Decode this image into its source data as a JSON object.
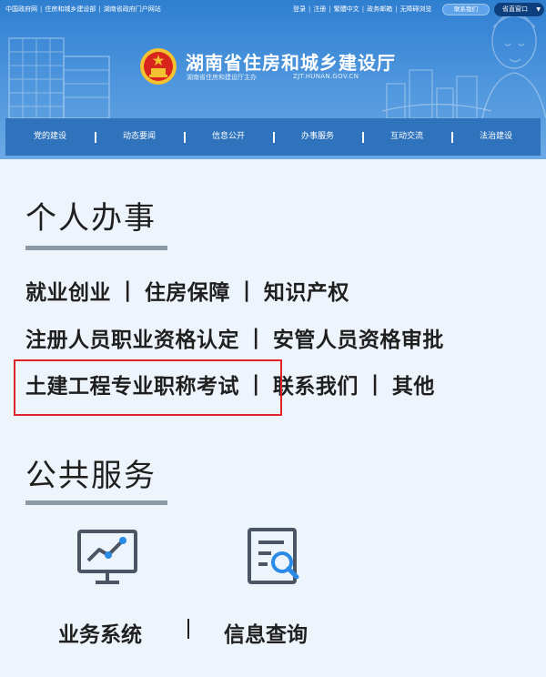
{
  "topbar": {
    "left_links": [
      "中国政府网",
      "住房和城乡建设部",
      "湖南省政府门户网站"
    ],
    "right_links": [
      "登录",
      "注册",
      "繁體中文",
      "政务邮箱",
      "无障碍浏览"
    ],
    "contact_button": "联系我们",
    "gov_window_button": "省直窗口"
  },
  "header": {
    "title": "湖南省住房和城乡建设厅",
    "subtitle": "湖南省住房和建设厅主办",
    "url": "ZJT.HUNAN.GOV.CN"
  },
  "nav": {
    "items": [
      "党的建设",
      "动态要闻",
      "信息公开",
      "办事服务",
      "互动交流",
      "法治建设"
    ]
  },
  "personal": {
    "title": "个人办事",
    "row1": [
      "就业创业",
      "住房保障",
      "知识产权"
    ],
    "row2": [
      "注册人员职业资格认定",
      "安管人员资格审批"
    ],
    "row3": [
      "土建工程专业职称考试",
      "联系我们",
      "其他"
    ],
    "separator": "|"
  },
  "public": {
    "title": "公共服务",
    "services": [
      {
        "label": "业务系统",
        "icon": "chart-monitor-icon"
      },
      {
        "label": "信息查询",
        "icon": "document-search-icon"
      }
    ]
  },
  "colors": {
    "nav_bg": "#2f73bd",
    "highlight": "#e0232b",
    "icon_gray": "#4b5563",
    "icon_accent": "#2a8be6"
  }
}
